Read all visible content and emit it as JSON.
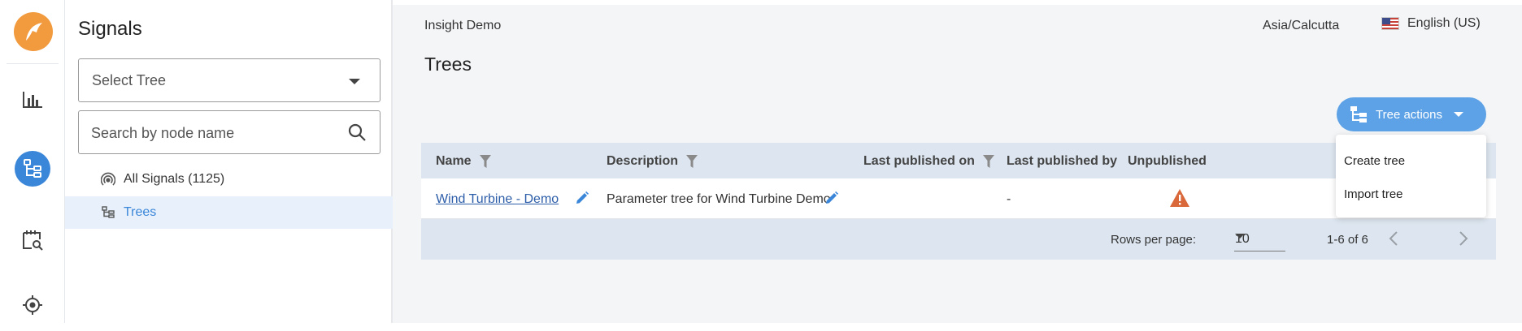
{
  "rail": {
    "icons": [
      "app-logo-icon",
      "bar-chart-icon",
      "tree-icon",
      "calendar-search-icon",
      "target-icon"
    ],
    "accent": "#3a86d9",
    "logo_color": "#f29a3e"
  },
  "panel": {
    "title": "Signals",
    "select_tree": "Select Tree",
    "search_placeholder": "Search by node name",
    "items": [
      {
        "label": "All Signals (1125)",
        "icon": "signal-icon"
      },
      {
        "label": "Trees",
        "icon": "tree-icon",
        "active": true
      }
    ]
  },
  "header": {
    "breadcrumb": "Insight Demo",
    "timezone": "Asia/Calcutta",
    "language": "English (US)"
  },
  "main": {
    "title": "Trees",
    "tree_actions": "Tree actions",
    "dropdown": [
      "Create tree",
      "Import tree"
    ],
    "table": {
      "columns": [
        "Name",
        "Description",
        "Last published on",
        "Last published by",
        "Unpublished"
      ],
      "rows": [
        {
          "name": "Wind Turbine - Demo",
          "description": "Parameter tree for Wind Turbine Demo",
          "last_published_on": "",
          "last_published_by": "-"
        }
      ]
    },
    "pagination": {
      "rows_per_page_label": "Rows per page:",
      "rows_per_page": "10",
      "range": "1-6 of 6"
    }
  }
}
